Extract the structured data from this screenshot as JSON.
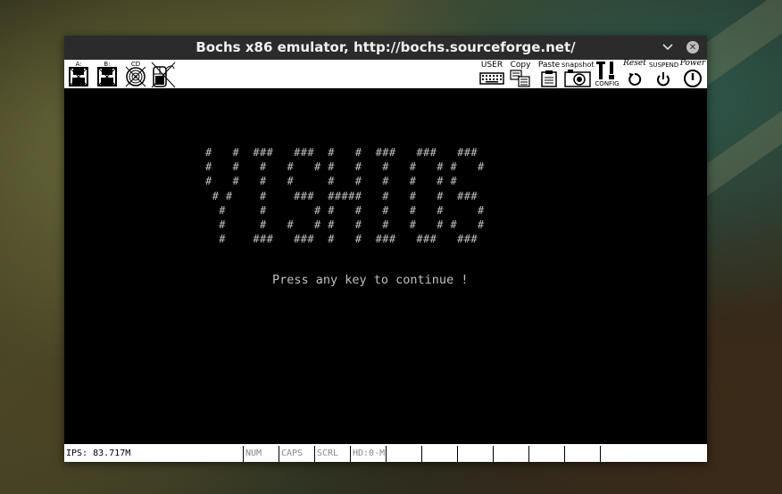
{
  "window": {
    "title": "Bochs x86 emulator, http://bochs.sourceforge.net/"
  },
  "toolbar": {
    "floppy_a": "A:",
    "floppy_b": "B:",
    "cdrom": "CD",
    "user": "USER",
    "copy": "Copy",
    "paste": "Paste",
    "snapshot": "snapshot",
    "config": "CONFIG",
    "reset": "Reset",
    "suspend": "SUSPEND",
    "power": "Power"
  },
  "screen": {
    "banner": "#   #  ###   ###  #   #  ###   ###   ###\n#   #   #   #   # #   #   #   #   # #   #\n#   #   #   #     #   #   #   #   # #\n # #    #    ###  #####   #   #   #  ###\n  #     #       # #   #   #   #   #     #\n  #     #   #   # #   #   #   #   # #   #\n  #    ###   ###  #   #  ###   ###   ###",
    "prompt": "Press any key to continue !"
  },
  "statusbar": {
    "ips": "IPS: 83.717M",
    "num": "NUM",
    "caps": "CAPS",
    "scrl": "SCRL",
    "hd": "HD:0-M"
  }
}
